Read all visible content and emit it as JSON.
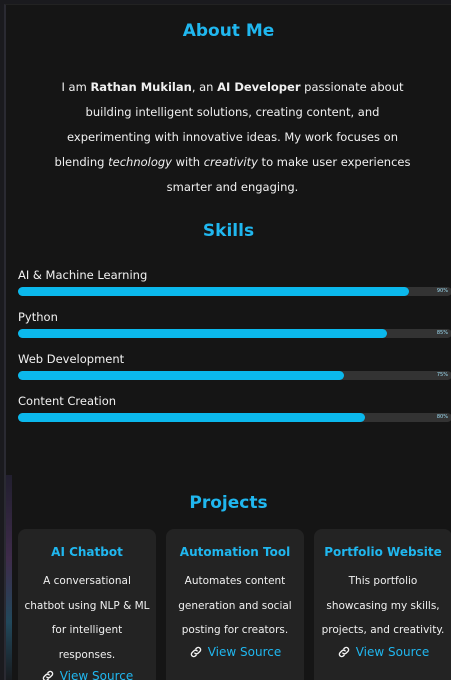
{
  "about": {
    "title": "About Me",
    "intro": "I am ",
    "name": "Rathan Mukilan",
    "mid": ", an ",
    "role": "AI Developer",
    "rest": " passionate about building intelligent solutions, creating content, and experimenting with innovative ideas. My work focuses on blending ",
    "tech": "technology",
    "with": " with ",
    "creativity": "creativity",
    "end": " to make user experiences smarter and engaging."
  },
  "skills": {
    "title": "Skills",
    "items": [
      {
        "name": "AI & Machine Learning",
        "label": "90%",
        "value": 0.9
      },
      {
        "name": "Python",
        "label": "85%",
        "value": 0.85
      },
      {
        "name": "Web Development",
        "label": "75%",
        "value": 0.75
      },
      {
        "name": "Content Creation",
        "label": "80%",
        "value": 0.8
      }
    ]
  },
  "projects": {
    "title": "Projects",
    "items": [
      {
        "title": "AI Chatbot",
        "desc": "A conversational chatbot using NLP & ML for intelligent responses.",
        "link": "View Source",
        "icon": "link-icon"
      },
      {
        "title": "Automation Tool",
        "desc": "Automates content generation and social posting for creators.",
        "link": "View Source",
        "icon": "link-icon"
      },
      {
        "title": "Portfolio Website",
        "desc": "This portfolio showcasing my skills, projects, and creativity.",
        "link": "View Source",
        "icon": "link-icon"
      }
    ]
  },
  "colors": {
    "accent": "#20b7ef",
    "bar_fill": "#0bb8ec",
    "bar_track": "#333333",
    "background": "#151515",
    "card": "#232323"
  }
}
